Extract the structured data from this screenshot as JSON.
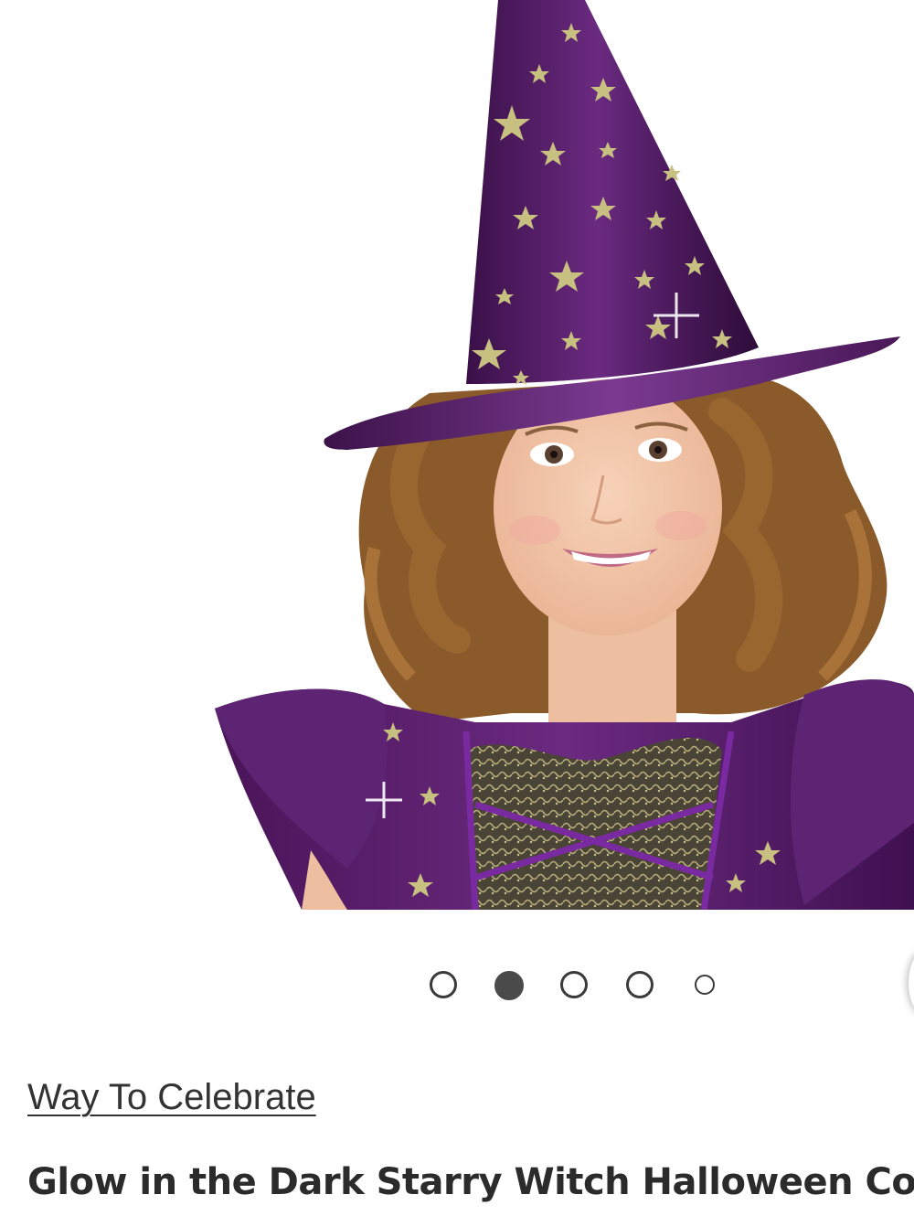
{
  "product": {
    "brand": "Way To Celebrate",
    "title": "Glow in the Dark Starry Witch Halloween Costu"
  },
  "carousel": {
    "total": 5,
    "active_index": 2
  },
  "image": {
    "subject": "child-in-purple-starry-witch-costume",
    "colors": {
      "hat": "#4b1a5c",
      "dress": "#5a1e6b",
      "stars": "#c8c080",
      "hair": "#8a5a2a",
      "skin": "#f2c4a8"
    }
  }
}
